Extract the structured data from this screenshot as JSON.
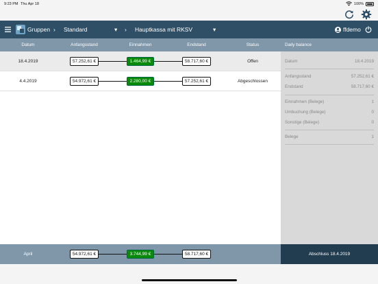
{
  "status": {
    "time": "9:23 PM",
    "day": "Thu Apr 18",
    "battery": "100%"
  },
  "nav": {
    "groups": "Gruppen",
    "standard": "Standard",
    "kasse": "Hauptkassa mit RKSV",
    "user": "ffdemo"
  },
  "table": {
    "headers": {
      "datum": "Datum",
      "anfangsstand": "Anfangsstand",
      "einnahmen": "Einnahmen",
      "endstand": "Endstand",
      "status": "Status"
    },
    "rows": [
      {
        "datum": "18.4.2019",
        "anfangsstand": "57.252,61 €",
        "einnahmen": "1.464,99 €",
        "endstand": "58.717,60 €",
        "status": "Offen"
      },
      {
        "datum": "4.4.2019",
        "anfangsstand": "54.972,61 €",
        "einnahmen": "2.280,00 €",
        "endstand": "57.252,61 €",
        "status": "Abgeschlossen"
      }
    ]
  },
  "side": {
    "title": "Daily balance",
    "datum_label": "Datum",
    "datum_value": "18.4.2019",
    "anf_label": "Anfangsstand",
    "anf_value": "57.252,61 €",
    "end_label": "Endstand",
    "end_value": "58.717,60 €",
    "ein_label": "Einnahmen (Belege)",
    "ein_value": "1",
    "umb_label": "Umbuchung (Belege)",
    "umb_value": "0",
    "son_label": "Sonstige (Belege)",
    "son_value": "0",
    "bel_label": "Belege",
    "bel_value": "1"
  },
  "footer": {
    "month": "April",
    "anfangsstand": "54.972,61 €",
    "einnahmen": "3.744,99 €",
    "endstand": "58.717,60 €",
    "close_button": "Abschluss 18.4.2019"
  },
  "colors": {
    "navbar": "#2e4f66",
    "header": "#7f97a9",
    "green": "#0a8a0a",
    "dark_button": "#233d50"
  }
}
